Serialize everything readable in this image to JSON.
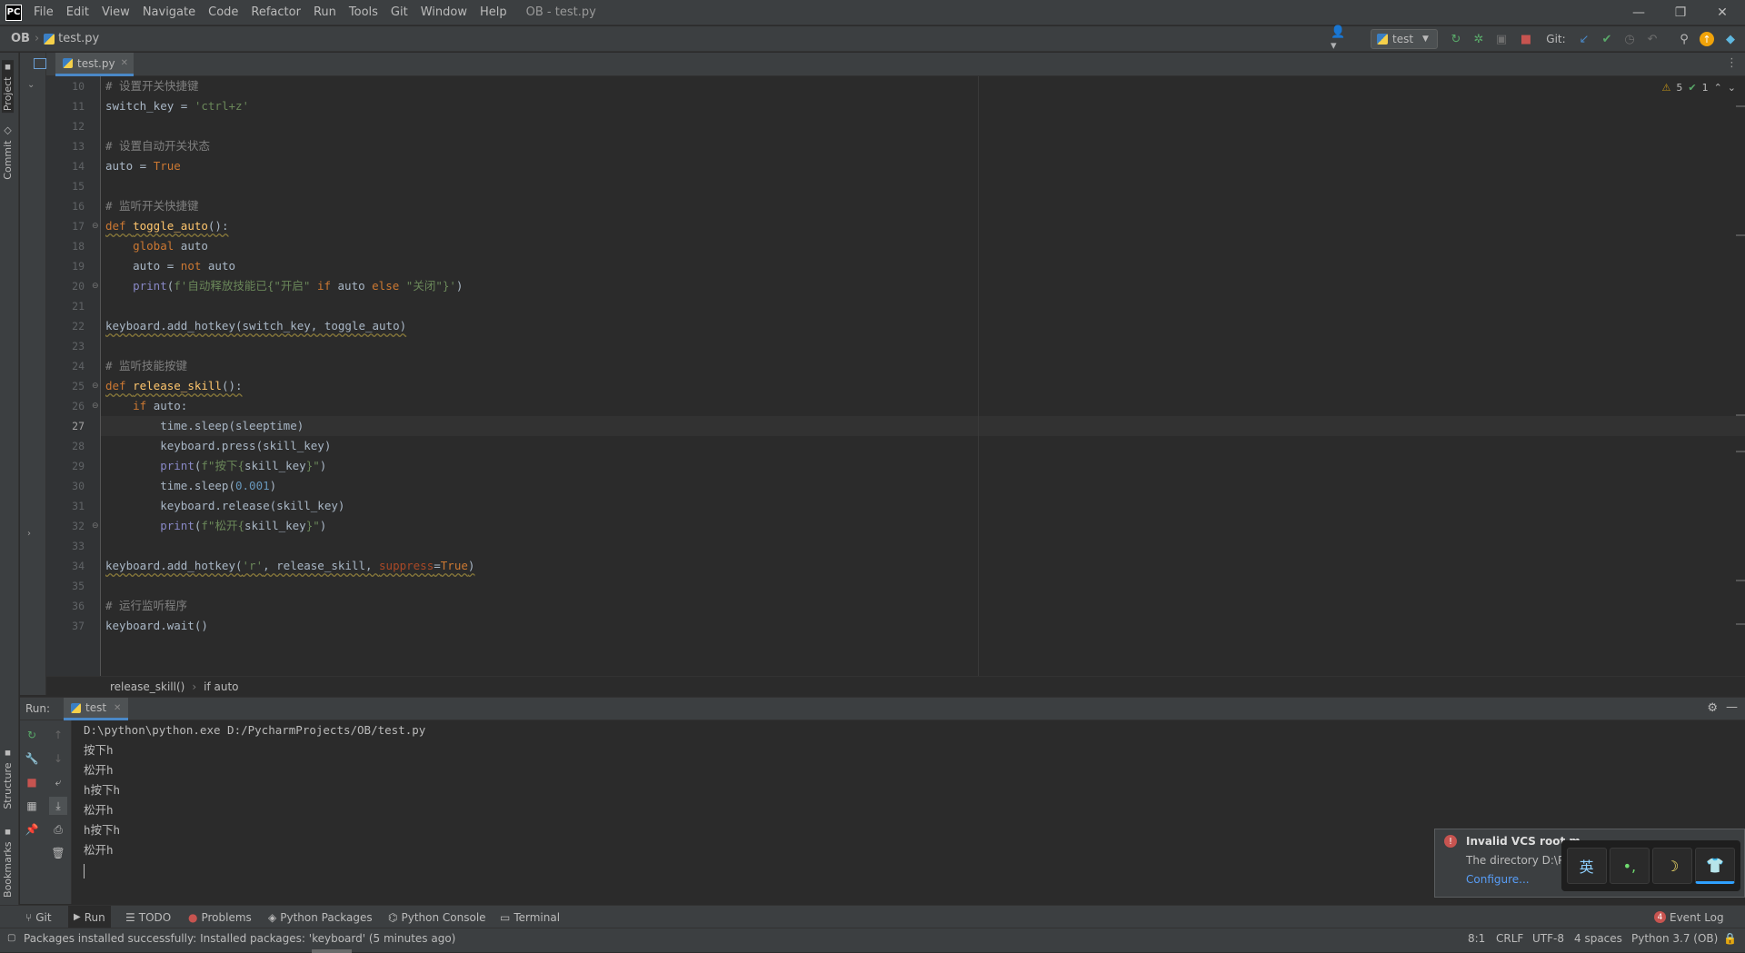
{
  "menu": [
    "File",
    "Edit",
    "View",
    "Navigate",
    "Code",
    "Refactor",
    "Run",
    "Tools",
    "Git",
    "Window",
    "Help"
  ],
  "window_title": "OB - test.py",
  "nav": {
    "project": "OB",
    "file": "test.py"
  },
  "run_config": "test",
  "git_label": "Git:",
  "left_tools": {
    "project": "Project",
    "commit": "Commit",
    "structure": "Structure",
    "bookmarks": "Bookmarks"
  },
  "editor_tab": "test.py",
  "inspections": {
    "warnings": "5",
    "ok": "1"
  },
  "line_numbers": [
    "10",
    "11",
    "12",
    "13",
    "14",
    "15",
    "16",
    "17",
    "18",
    "19",
    "20",
    "21",
    "22",
    "23",
    "24",
    "25",
    "26",
    "27",
    "28",
    "29",
    "30",
    "31",
    "32",
    "33",
    "34",
    "35",
    "36",
    "37"
  ],
  "code": {
    "c10": "# 设置开关快捷键",
    "c11_a": "switch_key = ",
    "c11_b": "'ctrl+z'",
    "c13": "# 设置自动开关状态",
    "c14_a": "auto = ",
    "c14_b": "True",
    "c16": "# 监听开关快捷键",
    "c17_a": "def ",
    "c17_b": "toggle_auto",
    "c17_c": "():",
    "c18_a": "    global ",
    "c18_b": "auto",
    "c19_a": "    auto = ",
    "c19_b": "not ",
    "c19_c": "auto",
    "c20_a": "    ",
    "c20_b": "print",
    "c20_c": "(",
    "c20_d": "f'自动释放技能已{",
    "c20_e": "\"开启\" ",
    "c20_f": "if ",
    "c20_g": "auto ",
    "c20_h": "else ",
    "c20_i": "\"关闭\"",
    "c20_j": "}'",
    "c20_k": ")",
    "c22": "keyboard.add_hotkey(switch_key, toggle_auto)",
    "c24": "# 监听技能按键",
    "c25_a": "def ",
    "c25_b": "release_skill",
    "c25_c": "():",
    "c26_a": "    if ",
    "c26_b": "auto:",
    "c27": "        time.sleep(sleeptime)",
    "c28": "        keyboard.press(skill_key)",
    "c29_a": "        ",
    "c29_b": "print",
    "c29_c": "(",
    "c29_d": "f\"按下{",
    "c29_e": "skill_key",
    "c29_f": "}\"",
    "c29_g": ")",
    "c30_a": "        time.sleep(",
    "c30_b": "0.001",
    "c30_c": ")",
    "c31": "        keyboard.release(skill_key)",
    "c32_a": "        ",
    "c32_b": "print",
    "c32_c": "(",
    "c32_d": "f\"松开{",
    "c32_e": "skill_key",
    "c32_f": "}\"",
    "c32_g": ")",
    "c34_a": "keyboard.add_hotkey(",
    "c34_b": "'r'",
    "c34_c": ", release_skill, ",
    "c34_d": "suppress",
    "c34_e": "=",
    "c34_f": "True",
    "c34_g": ")",
    "c36": "# 运行监听程序",
    "c37": "keyboard.wait()"
  },
  "breadcrumb": {
    "func": "release_skill()",
    "sep": "›",
    "block": "if auto"
  },
  "run": {
    "label": "Run:",
    "tab": "test"
  },
  "console": [
    "D:\\python\\python.exe D:/PycharmProjects/OB/test.py",
    "按下h",
    "松开h",
    "h按下h",
    "松开h",
    "h按下h",
    "松开h"
  ],
  "bottom_tabs": {
    "git": "Git",
    "run": "Run",
    "todo": "TODO",
    "problems": "Problems",
    "packages": "Python Packages",
    "console": "Python Console",
    "terminal": "Terminal",
    "event_log": "Event Log",
    "event_count": "4"
  },
  "status": {
    "message": "Packages installed successfully: Installed packages: 'keyboard' (5 minutes ago)",
    "position": "8:1",
    "line_sep": "CRLF",
    "encoding": "UTF-8",
    "indent": "4 spaces",
    "interpreter": "Python 3.7 (OB)"
  },
  "notification": {
    "title": "Invalid VCS root m...",
    "body": "The directory D:\\Py...",
    "link": "Configure..."
  },
  "ime": {
    "lang": "英",
    "punct": "•,",
    "moon": "☽",
    "shirt": "👕"
  },
  "colors": {
    "accent": "#4a88c7",
    "bg": "#2b2b2b",
    "panel": "#3c3f41"
  }
}
